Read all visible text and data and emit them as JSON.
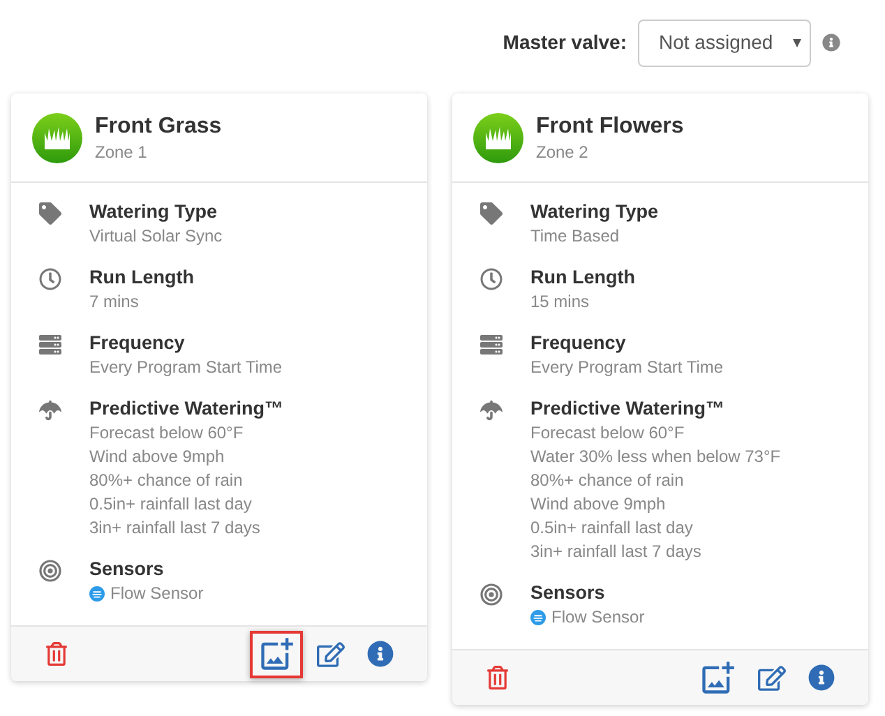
{
  "master_valve": {
    "label": "Master valve:",
    "value": "Not assigned"
  },
  "zones": [
    {
      "name": "Front Grass",
      "zone": "Zone 1",
      "details": [
        {
          "kind": "tag",
          "label": "Watering Type",
          "values": [
            "Virtual Solar Sync"
          ]
        },
        {
          "kind": "clock",
          "label": "Run Length",
          "values": [
            "7 mins"
          ]
        },
        {
          "kind": "frequency",
          "label": "Frequency",
          "values": [
            "Every Program Start Time"
          ]
        },
        {
          "kind": "umbrella",
          "label": "Predictive Watering™",
          "values": [
            "Forecast below 60°F",
            "Wind above 9mph",
            "80%+ chance of rain",
            "0.5in+ rainfall last day",
            "3in+ rainfall last 7 days"
          ]
        },
        {
          "kind": "sensors",
          "label": "Sensors",
          "values": [
            "Flow Sensor"
          ]
        }
      ],
      "actions": [
        {
          "kind": "delete",
          "highlighted": false
        },
        {
          "kind": "add-image",
          "highlighted": true
        },
        {
          "kind": "edit",
          "highlighted": false
        },
        {
          "kind": "info",
          "highlighted": false
        }
      ]
    },
    {
      "name": "Front Flowers",
      "zone": "Zone 2",
      "details": [
        {
          "kind": "tag",
          "label": "Watering Type",
          "values": [
            "Time Based"
          ]
        },
        {
          "kind": "clock",
          "label": "Run Length",
          "values": [
            "15 mins"
          ]
        },
        {
          "kind": "frequency",
          "label": "Frequency",
          "values": [
            "Every Program Start Time"
          ]
        },
        {
          "kind": "umbrella",
          "label": "Predictive Watering™",
          "values": [
            "Forecast below 60°F",
            "Water 30% less when below 73°F",
            "80%+ chance of rain",
            "Wind above 9mph",
            "0.5in+ rainfall last day",
            "3in+ rainfall last 7 days"
          ]
        },
        {
          "kind": "sensors",
          "label": "Sensors",
          "values": [
            "Flow Sensor"
          ]
        }
      ],
      "actions": [
        {
          "kind": "delete",
          "highlighted": false
        },
        {
          "kind": "add-image",
          "highlighted": false
        },
        {
          "kind": "edit",
          "highlighted": false
        },
        {
          "kind": "info",
          "highlighted": false
        }
      ]
    }
  ]
}
